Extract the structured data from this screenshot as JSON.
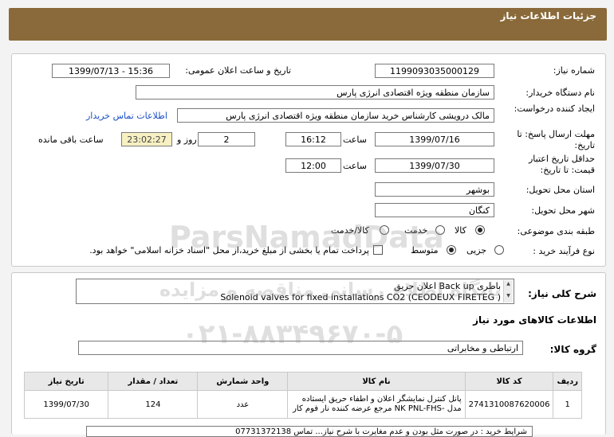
{
  "header": {
    "title": "جزئیات اطلاعات نیاز"
  },
  "form": {
    "need_number_label": "شماره نیاز:",
    "need_number": "1199093035000129",
    "announce_label": "تاریخ و ساعت اعلان عمومی:",
    "announce_value": "1399/07/13 - 15:36",
    "buyer_org_label": "نام دستگاه خریدار:",
    "buyer_org": "سازمان منطقه ویژه اقتصادی انرژی پارس",
    "creator_label": "ایجاد کننده درخواست:",
    "creator": "مالک  درویشی کارشناس خرید سازمان منطقه ویژه اقتصادی انرژی پارس",
    "contact_link": "اطلاعات تماس خریدار",
    "deadline_label": "مهلت ارسال پاسخ: تا تاریخ:",
    "deadline_date": "1399/07/16",
    "time_label": "ساعت",
    "deadline_time": "16:12",
    "days_value": "2",
    "days_label": "روز و",
    "remaining_time": "23:02:27",
    "remaining_label": "ساعت باقی مانده",
    "validity_label": "حداقل تاریخ اعتبار قیمت: تا تاریخ:",
    "validity_date": "1399/07/30",
    "validity_time": "12:00",
    "province_label": "استان محل تحویل:",
    "province": "بوشهر",
    "city_label": "شهر محل تحویل:",
    "city": "کنگان",
    "category_label": "طبقه بندی موضوعی:",
    "category_options": [
      "کالا",
      "خدمت",
      "کالا/خدمت"
    ],
    "process_label": "نوع فرآیند خرید :",
    "process_options": [
      "جزیی",
      "متوسط"
    ],
    "payment_note": "پرداخت تمام یا بخشی از مبلغ خرید،از محل \"اسناد خزانه اسلامی\" خواهد بود."
  },
  "summary": {
    "label": "شرح کلی نیاز:",
    "line1": "باطری Back up  اعلان حریق",
    "line2": "Solenoid valves for fixed installations   CO2 (CEODEUX FIRETEG )"
  },
  "goods": {
    "section_title": "اطلاعات کالاهای مورد نیاز",
    "group_label": "گروه کالا:",
    "group_value": "ارتباطی و مخابراتی",
    "columns": [
      "ردیف",
      "کد کالا",
      "نام کالا",
      "واحد شمارش",
      "تعداد / مقدار",
      "تاریخ نیاز"
    ],
    "rows": [
      {
        "index": "1",
        "code": "2741310087620006",
        "name": "پانل کنترل نمایشگر اعلان و اطفاء حریق ایستاده مدل -NK PNL-FHS مرجع عرضه کننده نار فوم کار",
        "unit": "عدد",
        "qty": "124",
        "date": "1399/07/30"
      }
    ]
  },
  "footer_note": "شرایط خرید : در صورت مثل بودن و عدم مغایرت با شرح نیاز... تماس 07731372138",
  "watermark": {
    "brand": "ParsNamadData",
    "line1": "پایگاه اطلاع رسانی مناقصه و مزایده",
    "phone": "۰۲۱-۸۸۳۴۹۶۷۰-۵"
  }
}
